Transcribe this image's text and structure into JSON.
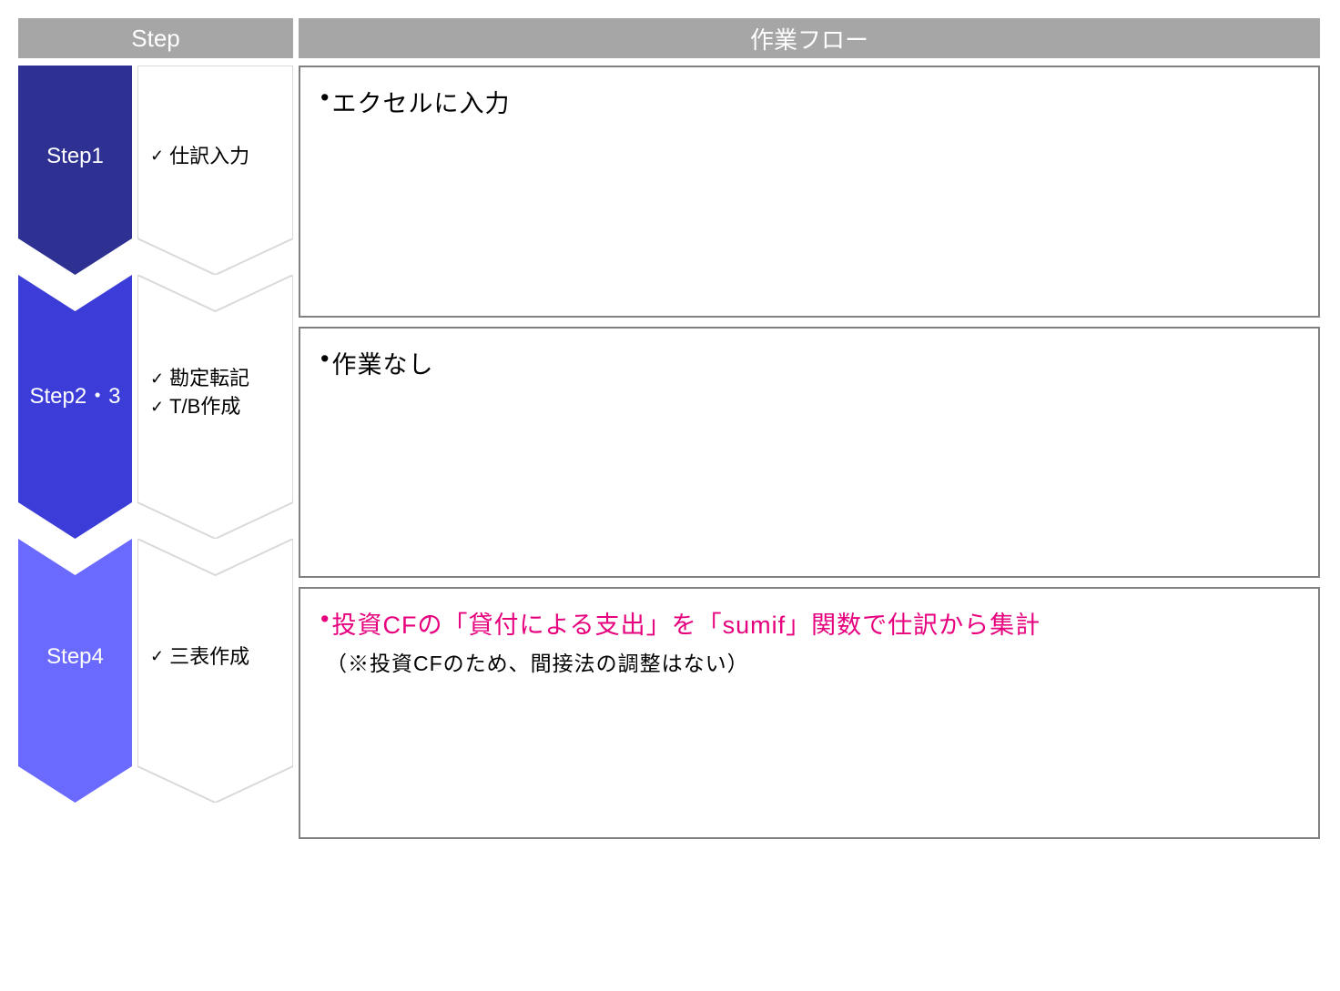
{
  "header": {
    "left": "Step",
    "right": "作業フロー"
  },
  "steps": [
    {
      "label": "Step1",
      "fill": "#2e3192",
      "desc": [
        "仕訳入力"
      ],
      "flow": {
        "main": "エクセルに入力",
        "highlight": false,
        "note": ""
      }
    },
    {
      "label": "Step2・3",
      "fill": "#3c3cd8",
      "desc": [
        "勘定転記",
        "T/B作成"
      ],
      "flow": {
        "main": "作業なし",
        "highlight": false,
        "note": ""
      }
    },
    {
      "label": "Step4",
      "fill": "#6a6aff",
      "desc": [
        "三表作成"
      ],
      "flow": {
        "main": "投資CFの「貸付による支出」を「sumif」関数で仕訳から集計",
        "highlight": true,
        "note": "（※投資CFのため、間接法の調整はない）"
      }
    }
  ],
  "tick_char": "✓",
  "bullet_char": "•"
}
